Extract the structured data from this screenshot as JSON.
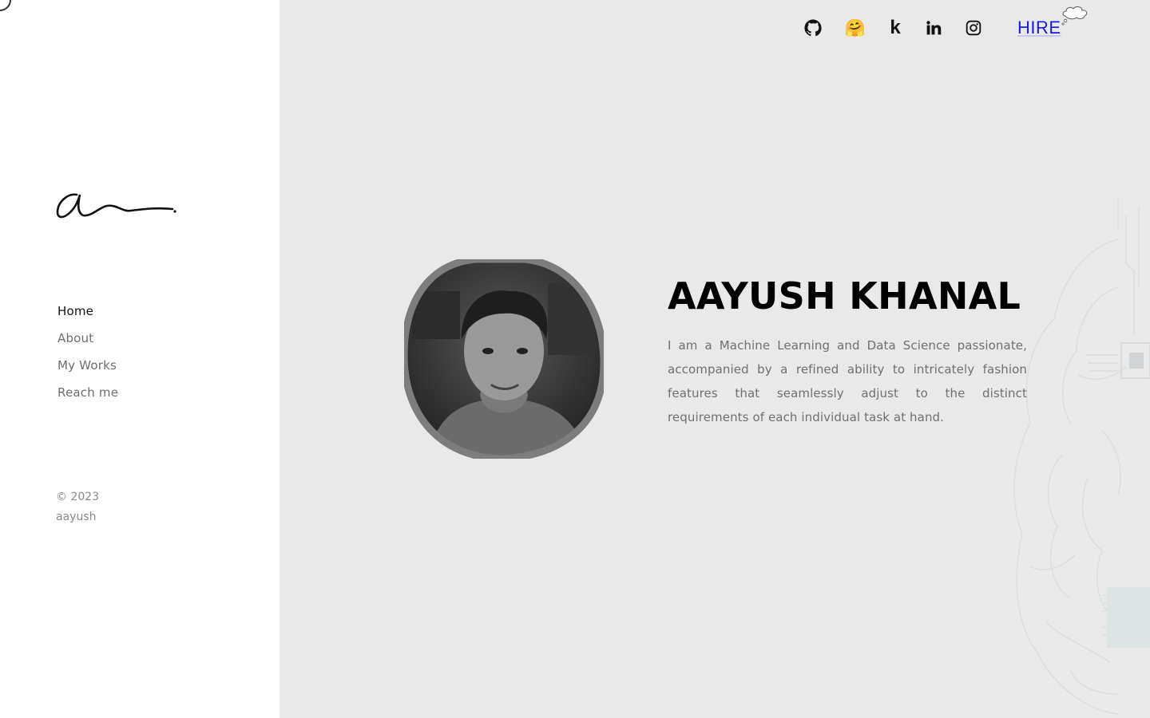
{
  "sidebar": {
    "nav": [
      {
        "label": "Home",
        "active": true
      },
      {
        "label": "About",
        "active": false
      },
      {
        "label": "My Works",
        "active": false
      },
      {
        "label": "Reach me",
        "active": false
      }
    ],
    "copyright_year": "© 2023",
    "copyright_name": "aayush"
  },
  "header": {
    "social_icons": [
      "github-icon",
      "huggingface-icon",
      "kaggle-icon",
      "linkedin-icon",
      "instagram-icon"
    ],
    "kaggle_glyph": "k",
    "huggingface_glyph": "🤗",
    "hire_label": "HIRE"
  },
  "hero": {
    "name": "AAYUSH KHANAL",
    "bio": "I am a Machine Learning and Data Science passionate, accompanied by a refined ability to intricately fashion features that seamlessly adjust to the distinct requirements of each individual task at hand."
  },
  "colors": {
    "accent_link": "#1a17e0",
    "sidebar_bg": "#ffffff",
    "main_bg": "#e9e9e9",
    "nav_active": "#111111",
    "nav_inactive": "#6d6d6d"
  }
}
